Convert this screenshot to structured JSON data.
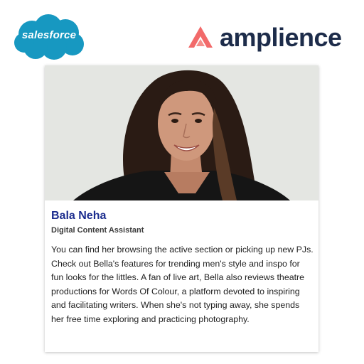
{
  "logos": {
    "salesforce": "salesforce",
    "amplience": "amplience",
    "colors": {
      "salesforce_blue": "#1798c1",
      "amplience_coral": "#f26a6a",
      "amplience_navy": "#1d2c4a"
    }
  },
  "profile": {
    "photo_icon": "person-portrait",
    "name": "Bala Neha",
    "title": "Digital Content Assistant",
    "bio": "You can find her browsing the active section or picking up new PJs. Check out Bella's features for trending men's style and inspo for fun looks for the littles. A fan of live art, Bella also reviews theatre productions for Words Of Colour, a platform devoted to inspiring and facilitating writers. When she's not typing away, she spends her free time exploring and practicing photography.",
    "name_color": "#1b2c8e"
  }
}
